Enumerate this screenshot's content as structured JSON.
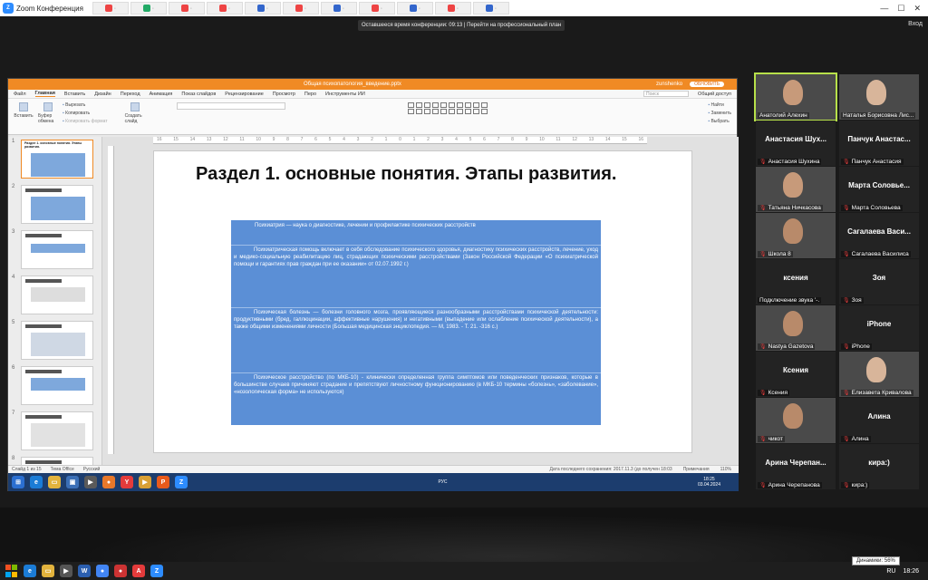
{
  "zoom": {
    "window_title": "Zoom Конференция",
    "timer_text": "Оставшееся время конференции: 09:13 | Перейти на профессиональный план",
    "exit_label": "Вход",
    "min": "—",
    "max": "☐",
    "close": "✕"
  },
  "wps": {
    "file_name": "Общая психопатология_введение.pptx",
    "user": "zunshenko",
    "update_btn": "ОБНОВИТЬ",
    "menu": [
      "Файл",
      "Главная",
      "Вставить",
      "Дизайн",
      "Переход",
      "Анимация",
      "Показ слайдов",
      "Рецензирование",
      "Просмотр",
      "Перо",
      "Инструменты ИИ"
    ],
    "search_placeholder": "Поиск",
    "share_label": "Общий доступ",
    "ribbon": {
      "paste": "Вставить",
      "clipboard": "Буфер обмена",
      "cut": "Вырезать",
      "copy": "Копировать",
      "format": "Копировать формат",
      "new_slide": "Создать слайд",
      "find": "Найти",
      "replace": "Заменить",
      "select": "Выбрать"
    }
  },
  "slide": {
    "title": "Раздел 1. основные понятия. Этапы развития.",
    "p1": "Психиатрия — наука о диагностике, лечении и профилактике психических расстройств",
    "p2": "Психиатрическая помощь включает в себя обследование психического здоровья, диагностику психических расстройств, лечение, уход и медико-социальную реабилитацию лиц, страдающих психическими расстройствами (Закон Российской Федерации «О психиатрической помощи и гарантиях прав граждан при ее оказании» от 02.07.1992 г.)",
    "p3": "Психическая болезнь — болезни головного мозга, проявляющиеся разнообразными расстройствами психической деятельности: продуктивными (бред, галлюцинации, аффективные нарушения) и негативными (выпадение или ослабление психической деятельности), а также общими изменениями личности (Большая медицинская энциклопедия. — М, 1983. - Т. 21. -316 с.)",
    "p4": "Психическое расстройство (по МКБ-10) - клинически определенная группа симптомов или поведенческих признаков, которые в большинстве случаев причиняют страдание и препятствуют личностному функционированию (в МКБ-10 термины «болезнь», «заболевание», «нозологическая форма» не используются)",
    "thumb_title": "Раздел 1. основные понятия. Этапы развития.",
    "thumb_numbers": [
      "1",
      "2",
      "3",
      "4",
      "5",
      "6",
      "7",
      "8"
    ],
    "ruler_ticks": [
      "16",
      "15",
      "14",
      "13",
      "12",
      "11",
      "10",
      "9",
      "8",
      "7",
      "6",
      "5",
      "4",
      "3",
      "2",
      "1",
      "0",
      "1",
      "2",
      "3",
      "4",
      "5",
      "6",
      "7",
      "8",
      "9",
      "10",
      "11",
      "12",
      "13",
      "14",
      "15",
      "16"
    ]
  },
  "status": {
    "slide_info": "Слайд 1 из 15",
    "theme": "Тема Office",
    "lang": "Русский",
    "saved": "Дата последнего сохранения: 2017.11.3 (до получен 18:03",
    "notes": "Примечания",
    "zoom": "110%",
    "inner_clock_time": "18:25",
    "inner_clock_date": "03.04.2024",
    "inner_lang": "РУС"
  },
  "participants": [
    {
      "big": "",
      "cap": "Анатолий Алехин",
      "video": true,
      "active": true,
      "muted": false
    },
    {
      "big": "",
      "cap": "Наталья Борисовна Лис...",
      "video": true,
      "muted": false
    },
    {
      "big": "Анастасия Шух...",
      "cap": "Анастасия Шухина",
      "muted": true
    },
    {
      "big": "Панчук Анастас...",
      "cap": "Панчук Анастасия",
      "muted": true
    },
    {
      "big": "",
      "cap": "Татьяна Ничкасова",
      "video": true,
      "muted": true
    },
    {
      "big": "Марта Соловье...",
      "cap": "Марта Соловьева",
      "muted": true
    },
    {
      "big": "",
      "cap": "Школа 8",
      "video": true,
      "muted": true
    },
    {
      "big": "Сагалаева Васи...",
      "cap": "Сагалаева Василиса",
      "muted": true
    },
    {
      "big": "ксения",
      "cap": "Подключение звука '-.",
      "muted": false
    },
    {
      "big": "Зоя",
      "cap": "Зоя",
      "muted": true
    },
    {
      "big": "",
      "cap": "Nastya Gazetova",
      "video": true,
      "muted": true
    },
    {
      "big": "iPhone",
      "cap": "iPhone",
      "muted": true
    },
    {
      "big": "Ксения",
      "cap": "Ксения",
      "muted": true
    },
    {
      "big": "",
      "cap": "Елизавета Кривалова",
      "video": true,
      "muted": true
    },
    {
      "big": "",
      "cap": "чикот",
      "video": true,
      "muted": true
    },
    {
      "big": "Алина",
      "cap": "Алина",
      "muted": true
    },
    {
      "big": "Арина Черепан...",
      "cap": "Арина Черепанова",
      "muted": true
    },
    {
      "big": "кира:)",
      "cap": "кира:)",
      "muted": true
    }
  ],
  "taskbar": {
    "lang": "RU",
    "time": "18:26",
    "volume_tip": "Динамики: 56%"
  },
  "colors": {
    "wps_orange": "#f08a24",
    "text_box": "#5b8fd6",
    "zoom_blue": "#2d8cff"
  }
}
